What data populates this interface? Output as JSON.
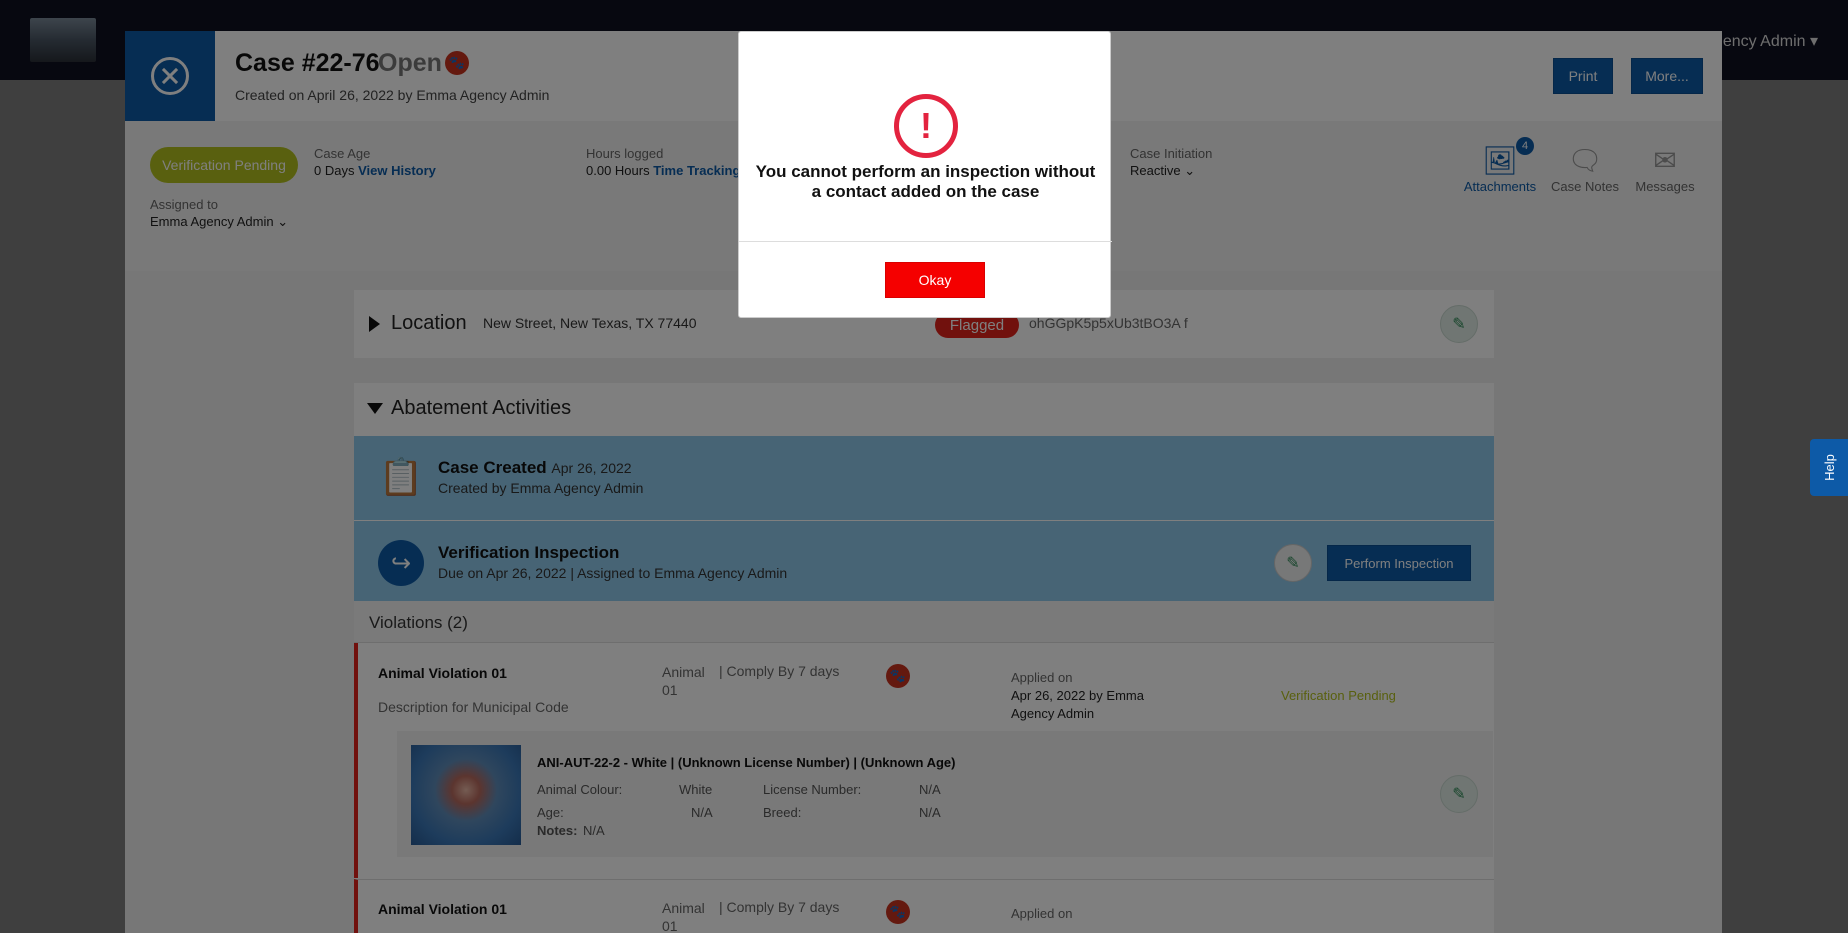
{
  "topbar": {
    "user_menu": "ency Admin ▾"
  },
  "case": {
    "title": "Case #22-76",
    "status": "Open",
    "created": "Created on April 26, 2022 by Emma Agency Admin",
    "print_label": "Print",
    "more_label": "More..."
  },
  "summary": {
    "pill": "Verification Pending",
    "case_age_label": "Case Age",
    "case_age_value": "0 Days",
    "view_history": "View History",
    "hours_label": "Hours logged",
    "hours_value": "0.00 Hours",
    "time_tracking": "Time Tracking",
    "initiation_label": "Case Initiation",
    "initiation_value": "Reactive",
    "assigned_label": "Assigned to",
    "assigned_value": "Emma Agency Admin",
    "tools": {
      "attachments": "Attachments",
      "attachments_count": "4",
      "case_notes": "Case Notes",
      "messages": "Messages"
    }
  },
  "location": {
    "title": "Location",
    "address": "New Street, New Texas, TX 77440",
    "flag": "Flagged",
    "code": "ohGGpK5p5xUb3tBO3A f"
  },
  "abatement": {
    "title": "Abatement Activities",
    "activities": [
      {
        "title": "Case Created",
        "date": "Apr 26, 2022",
        "sub": "Created by Emma Agency Admin"
      },
      {
        "title": "Verification Inspection",
        "date": "",
        "sub": "Due on Apr 26, 2022 | Assigned to Emma Agency Admin",
        "button": "Perform Inspection"
      }
    ]
  },
  "violations": {
    "heading": "Violations (2)",
    "items": [
      {
        "name": "Animal Violation 01",
        "code": "Animal 01",
        "comply": "| Comply By 7 days",
        "description": "Description for Municipal Code",
        "applied_label": "Applied on",
        "applied": "Apr 26, 2022 by Emma Agency Admin",
        "status": "Verification Pending",
        "animal": {
          "title": "ANI-AUT-22-2 - White | (Unknown License Number) | (Unknown Age)",
          "colour_label": "Animal Colour:",
          "colour": "White",
          "license_label": "License Number:",
          "license": "N/A",
          "age_label": "Age:",
          "age": "N/A",
          "breed_label": "Breed:",
          "breed": "N/A",
          "notes_label": "Notes:",
          "notes": "N/A"
        }
      },
      {
        "name": "Animal Violation 01",
        "code": "Animal 01",
        "comply": "| Comply By 7 days",
        "applied_label": "Applied on"
      }
    ]
  },
  "modal": {
    "message": "You cannot perform an inspection without a contact added on the case",
    "okay": "Okay"
  },
  "help": "Help",
  "colors": {
    "primary": "#0d5aa7",
    "danger": "#e2231a",
    "pending": "#b2c11e"
  }
}
